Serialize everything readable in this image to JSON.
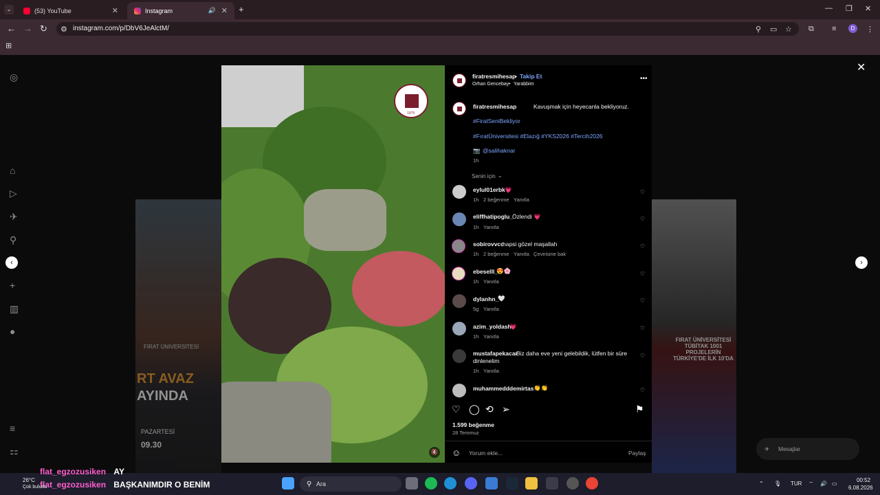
{
  "browser": {
    "tabs": [
      {
        "label": "(53) YouTube",
        "active": false
      },
      {
        "label": "Instagram",
        "active": true
      }
    ],
    "url": "instagram.com/p/DbV6JeAlctM/",
    "profile_initial": "D"
  },
  "background": {
    "left_card": {
      "university": "FIRAT ÜNİVERSİTESİ",
      "line1": "RT AVAZ",
      "line2": "AYINDA",
      "day": "PAZARTESİ",
      "time": "09.30",
      "avaz": "RT AVAZ"
    },
    "right_card": {
      "title": "FIRAT ÜNİVERSİTESİ TÜBİTAK 1001 PROJELERİN TÜRKİYE'DE İLK 10'DA"
    },
    "messages_label": "Mesajlar"
  },
  "post": {
    "author": "firatresmihesap",
    "follow_label": "Takip Et",
    "audio_artist": "Orhan Gencebay",
    "audio_title": "Yarabbim",
    "seal_year": "1975",
    "caption": "Kavuşmak için heyecanla bekliyoruz.",
    "hashtag_line1": "#FiratSeniBekliyor",
    "hashtag_line2": "#FıratÜniversitesi #Elazığ #YKS2026 #Tercih2026",
    "mention": "@salihaknar",
    "caption_time": "1h",
    "sort_label": "Senin için",
    "likes": "1.599 beğenme",
    "date": "28 Temmuz",
    "comment_placeholder": "Yorum ekle...",
    "share_label": "Paylaş"
  },
  "comments": [
    {
      "user": "eylul01erbk",
      "text": "💗",
      "time": "1h",
      "likes": "2 beğenme",
      "reply": "Yanıtla",
      "extra": ""
    },
    {
      "user": "eliffhatipoglu_",
      "text": "Özlendi 💗",
      "time": "1h",
      "likes": "",
      "reply": "Yanıtla",
      "extra": ""
    },
    {
      "user": "sobirovvcc",
      "text": "hapsi gözel maşallah",
      "time": "1h",
      "likes": "2 beğenme",
      "reply": "Yanıtla",
      "extra": "Çevirisine bak"
    },
    {
      "user": "ebeselll_",
      "text": "😍🌸",
      "time": "1h",
      "likes": "",
      "reply": "Yanıtla",
      "extra": ""
    },
    {
      "user": "dylanhn_",
      "text": "🤍",
      "time": "5g",
      "likes": "",
      "reply": "Yanıtla",
      "extra": ""
    },
    {
      "user": "azim_yoldash",
      "text": "💗",
      "time": "1h",
      "likes": "",
      "reply": "Yanıtla",
      "extra": ""
    },
    {
      "user": "mustafapekacar",
      "text": "Biz daha eve yeni gelebildik, lütfen bir süre",
      "text2": "dinlenelim",
      "time": "1h",
      "likes": "",
      "reply": "Yanıtla",
      "extra": ""
    },
    {
      "user": "muhammedddemirtas",
      "text": "👏👏",
      "time": "1h",
      "likes": "",
      "reply": "Yanıtla",
      "extra": ""
    }
  ],
  "stream_chat": [
    {
      "user": "flat_egzozusiken",
      "msg": "AY"
    },
    {
      "user": "flat_egzozusiken",
      "msg": "BAŞKANIMDIR O BENİM"
    }
  ],
  "taskbar": {
    "weather_temp": "26°C",
    "weather_text": "Çok bulutlu",
    "search_label": "Ara",
    "language": "TUR",
    "time": "00:52",
    "date": "6.08.2026"
  }
}
